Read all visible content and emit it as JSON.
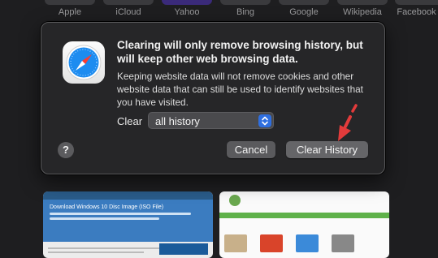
{
  "favorites": [
    {
      "label": "Apple"
    },
    {
      "label": "iCloud"
    },
    {
      "label": "Yahoo"
    },
    {
      "label": "Bing"
    },
    {
      "label": "Google"
    },
    {
      "label": "Wikipedia"
    },
    {
      "label": "Facebook"
    }
  ],
  "dialog": {
    "title": "Clearing will only remove browsing history, but will keep other web browsing data.",
    "message": "Keeping website data will not remove cookies and other website data that can still be used to identify websites that you have visited.",
    "clear_label": "Clear",
    "clear_range": "all history",
    "help_glyph": "?",
    "cancel_label": "Cancel",
    "confirm_label": "Clear History"
  },
  "thumbnails": {
    "first_title": "Download Windows 10 Disc Image (ISO File)"
  },
  "colors": {
    "accent": "#2f6fe0",
    "annotation_arrow": "#e23b3b"
  }
}
